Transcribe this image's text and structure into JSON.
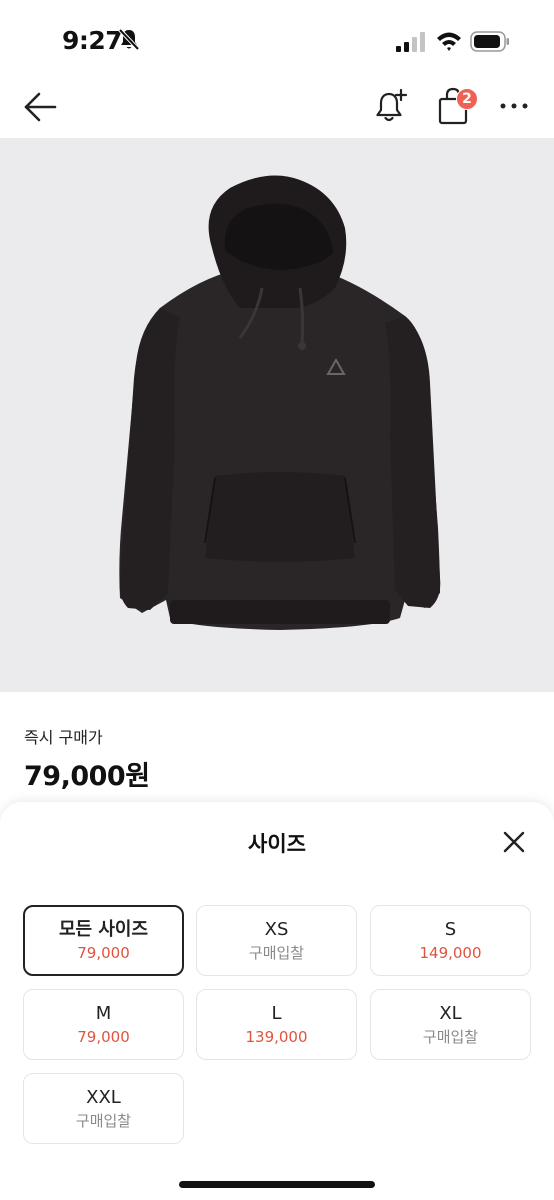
{
  "status_bar": {
    "time": "9:27"
  },
  "nav": {
    "bag_badge_count": "2"
  },
  "product": {
    "price_label": "즉시 구매가",
    "price_value": "79,000원"
  },
  "sheet": {
    "title": "사이즈",
    "sizes": [
      {
        "name": "모든 사이즈",
        "price": "79,000"
      },
      {
        "name": "XS",
        "price": "구매입찰"
      },
      {
        "name": "S",
        "price": "149,000"
      },
      {
        "name": "M",
        "price": "79,000"
      },
      {
        "name": "L",
        "price": "139,000"
      },
      {
        "name": "XL",
        "price": "구매입찰"
      },
      {
        "name": "XXL",
        "price": "구매입찰"
      }
    ]
  },
  "colors": {
    "accent_red": "#e0543f",
    "badge_red": "#ef6253",
    "image_bg": "#ebebed"
  }
}
